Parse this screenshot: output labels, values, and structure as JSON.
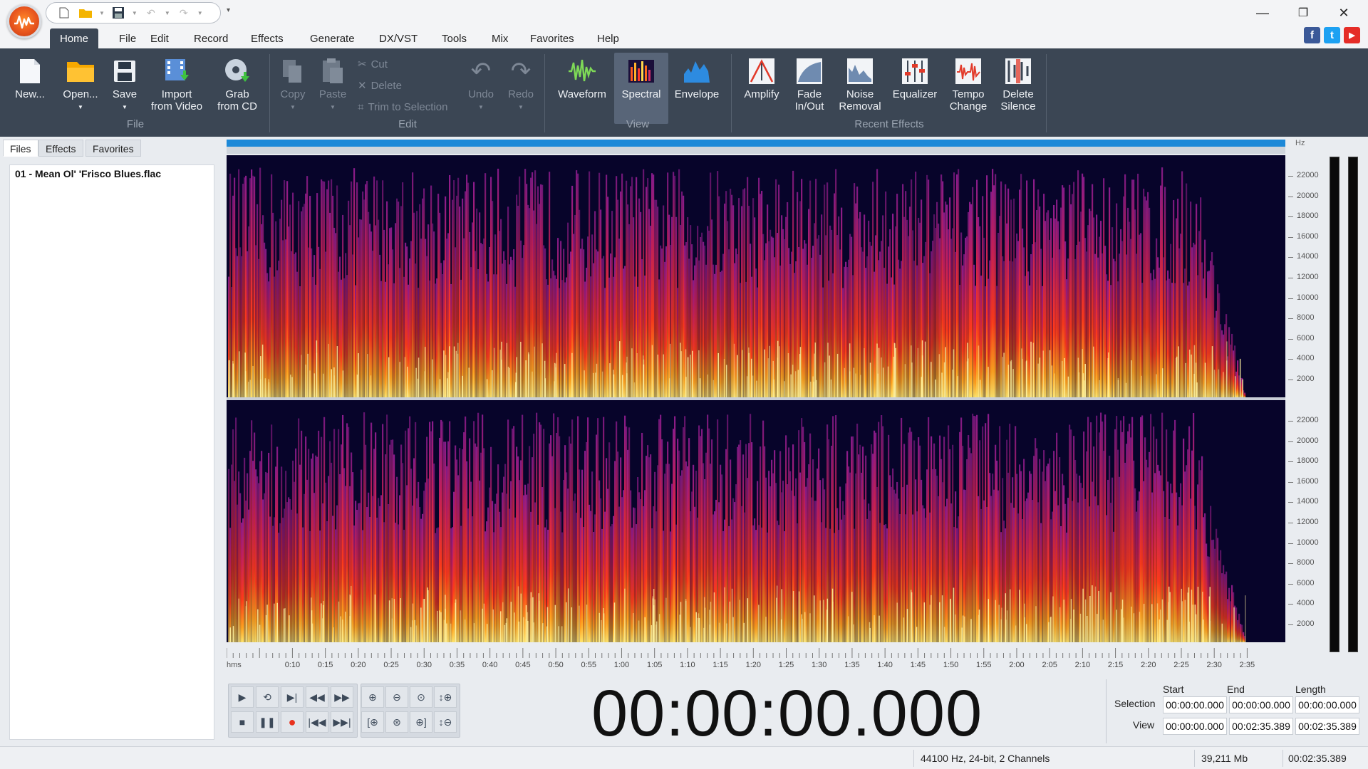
{
  "window": {
    "minimize_glyph": "—",
    "restore_glyph": "❐",
    "close_glyph": "✕"
  },
  "menu": {
    "tabs": [
      "Home",
      "File",
      "Edit",
      "Record",
      "Effects",
      "Generate",
      "DX/VST",
      "Tools",
      "Mix",
      "Favorites",
      "Help"
    ],
    "active": "Home"
  },
  "social": {
    "facebook": "f",
    "twitter": "t",
    "youtube": "▶"
  },
  "ribbon": {
    "file_group": {
      "label": "File",
      "new": "New...",
      "open": "Open...",
      "save": "Save",
      "import_line1": "Import",
      "import_line2": "from Video",
      "grab_line1": "Grab",
      "grab_line2": "from CD"
    },
    "edit_group": {
      "label": "Edit",
      "copy": "Copy",
      "paste": "Paste",
      "cut": "Cut",
      "delete": "Delete",
      "trim": "Trim to Selection",
      "undo": "Undo",
      "redo": "Redo"
    },
    "view_group": {
      "label": "View",
      "waveform": "Waveform",
      "spectral": "Spectral",
      "envelope": "Envelope"
    },
    "effects_group": {
      "label": "Recent Effects",
      "amplify": "Amplify",
      "fade_line1": "Fade",
      "fade_line2": "In/Out",
      "noise_line1": "Noise",
      "noise_line2": "Removal",
      "equalizer": "Equalizer",
      "tempo_line1": "Tempo",
      "tempo_line2": "Change",
      "silence_line1": "Delete",
      "silence_line2": "Silence"
    }
  },
  "panel": {
    "tabs": [
      "Files",
      "Effects",
      "Favorites"
    ],
    "active_tab": "Files",
    "files": [
      "01 - Mean Ol' 'Frisco Blues.flac"
    ]
  },
  "editor": {
    "hz_label": "Hz",
    "freq_ticks": [
      "22000",
      "20000",
      "18000",
      "16000",
      "14000",
      "12000",
      "10000",
      "8000",
      "6000",
      "4000",
      "2000"
    ],
    "hms_label": "hms",
    "time_ticks": [
      "0:10",
      "0:15",
      "0:20",
      "0:25",
      "0:30",
      "0:35",
      "0:40",
      "0:45",
      "0:50",
      "0:55",
      "1:00",
      "1:05",
      "1:10",
      "1:15",
      "1:20",
      "1:25",
      "1:30",
      "1:35",
      "1:40",
      "1:45",
      "1:50",
      "1:55",
      "2:00",
      "2:05",
      "2:10",
      "2:15",
      "2:20",
      "2:25",
      "2:30",
      "2:35"
    ],
    "colors": {
      "spectrum_bg": "#07042a",
      "spectrum_low": "#ffe36a",
      "spectrum_mid": "#ff3a1a",
      "spectrum_high": "#8a1c8e",
      "overview": "#1d89d8"
    }
  },
  "transport": {
    "time_display": "00:00:00.000"
  },
  "selection": {
    "headers": {
      "start": "Start",
      "end": "End",
      "length": "Length"
    },
    "selection_label": "Selection",
    "view_label": "View",
    "selection_start": "00:00:00.000",
    "selection_end": "00:00:00.000",
    "selection_length": "00:00:00.000",
    "view_start": "00:00:00.000",
    "view_end": "00:02:35.389",
    "view_length": "00:02:35.389"
  },
  "status": {
    "format": "44100 Hz, 24-bit, 2 Channels",
    "size": "39,211 Mb",
    "duration": "00:02:35.389"
  }
}
